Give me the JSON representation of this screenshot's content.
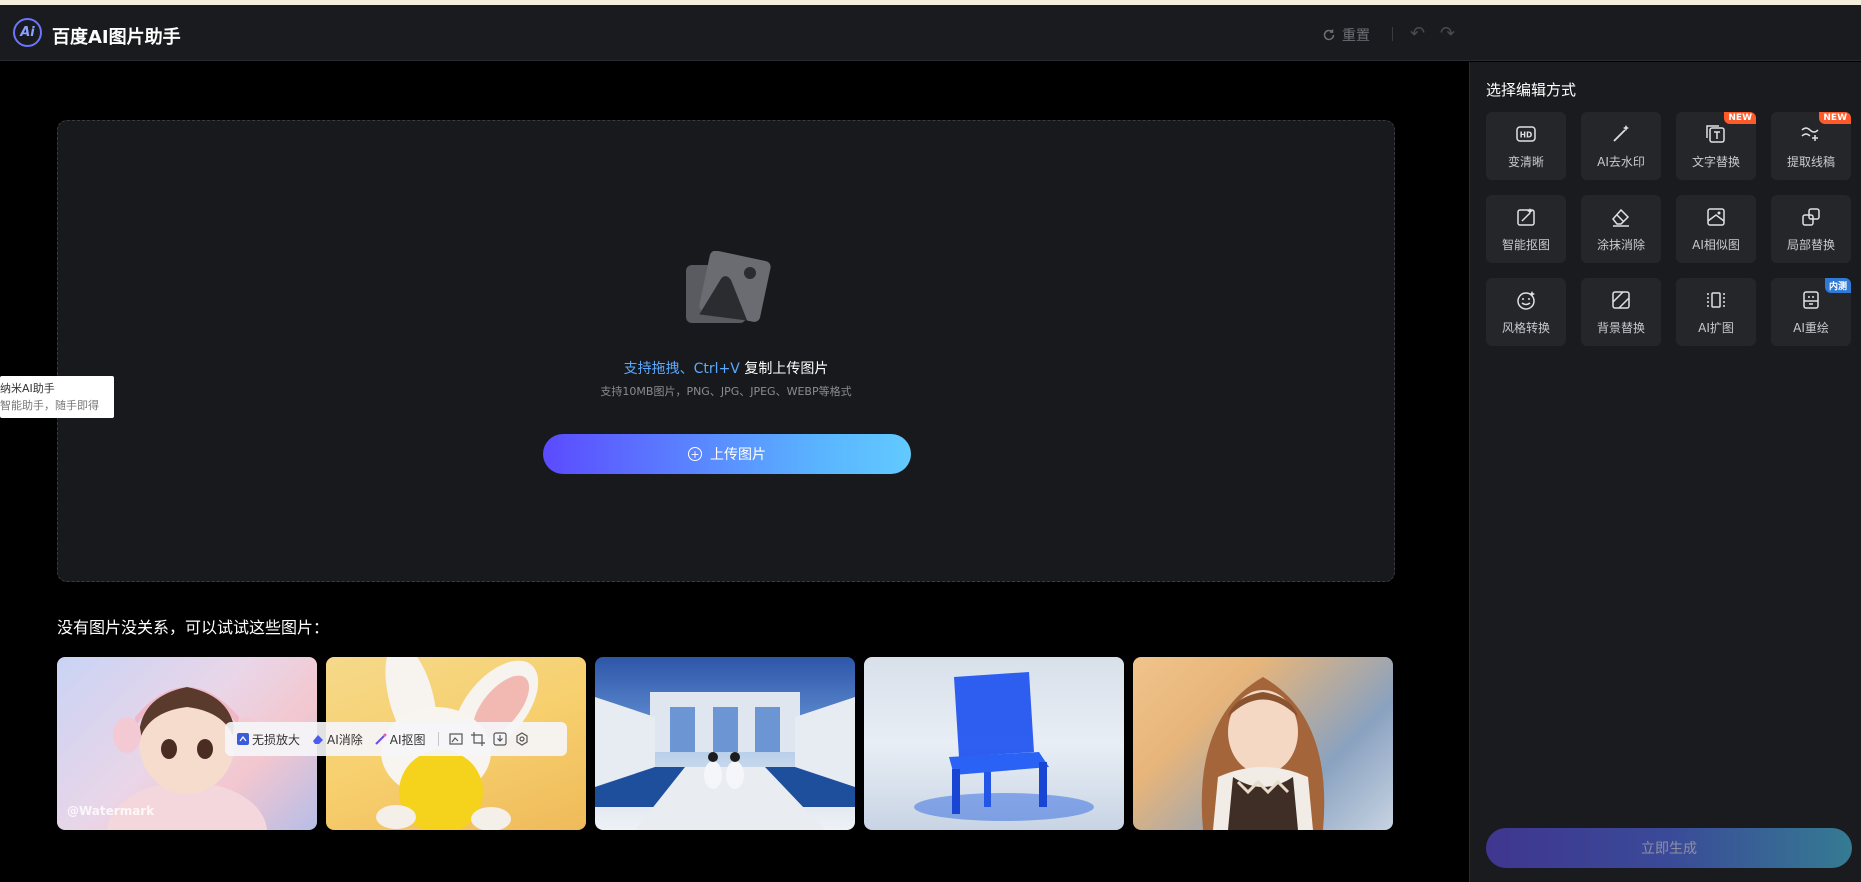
{
  "header": {
    "logo_text": "Ai",
    "title": "百度AI图片助手",
    "reset_label": "重置"
  },
  "upload": {
    "hint_highlight": "支持拖拽、Ctrl+V",
    "hint_text": " 复制上传图片",
    "formats": "支持10MB图片，PNG、JPG、JPEG、WEBP等格式",
    "button_label": "上传图片"
  },
  "samples": {
    "title": "没有图片没关系，可以试试这些图片：",
    "watermark": "@Watermark"
  },
  "float_toolbar": {
    "items": [
      "无损放大",
      "AI消除",
      "AI抠图"
    ]
  },
  "tooltip": {
    "line1": "纳米AI助手",
    "line2": "智能助手，随手即得"
  },
  "panel": {
    "title": "选择编辑方式",
    "tools": [
      {
        "label": "变清晰",
        "icon": "hd-icon"
      },
      {
        "label": "AI去水印",
        "icon": "magic-wand-icon"
      },
      {
        "label": "文字替换",
        "icon": "text-replace-icon",
        "badge": "NEW"
      },
      {
        "label": "提取线稿",
        "icon": "line-art-icon",
        "badge": "NEW"
      },
      {
        "label": "智能抠图",
        "icon": "cutout-icon"
      },
      {
        "label": "涂抹消除",
        "icon": "eraser-icon"
      },
      {
        "label": "AI相似图",
        "icon": "similar-image-icon"
      },
      {
        "label": "局部替换",
        "icon": "partial-replace-icon"
      },
      {
        "label": "风格转换",
        "icon": "style-icon"
      },
      {
        "label": "背景替换",
        "icon": "background-icon"
      },
      {
        "label": "AI扩图",
        "icon": "expand-icon"
      },
      {
        "label": "AI重绘",
        "icon": "redraw-icon",
        "badge": "内测"
      }
    ],
    "generate_label": "立即生成"
  },
  "colors": {
    "accent_gradient_start": "#5b4bff",
    "accent_gradient_end": "#5ab4ff",
    "badge_new": "#ff5a2a",
    "badge_beta": "#2f7ad6"
  }
}
